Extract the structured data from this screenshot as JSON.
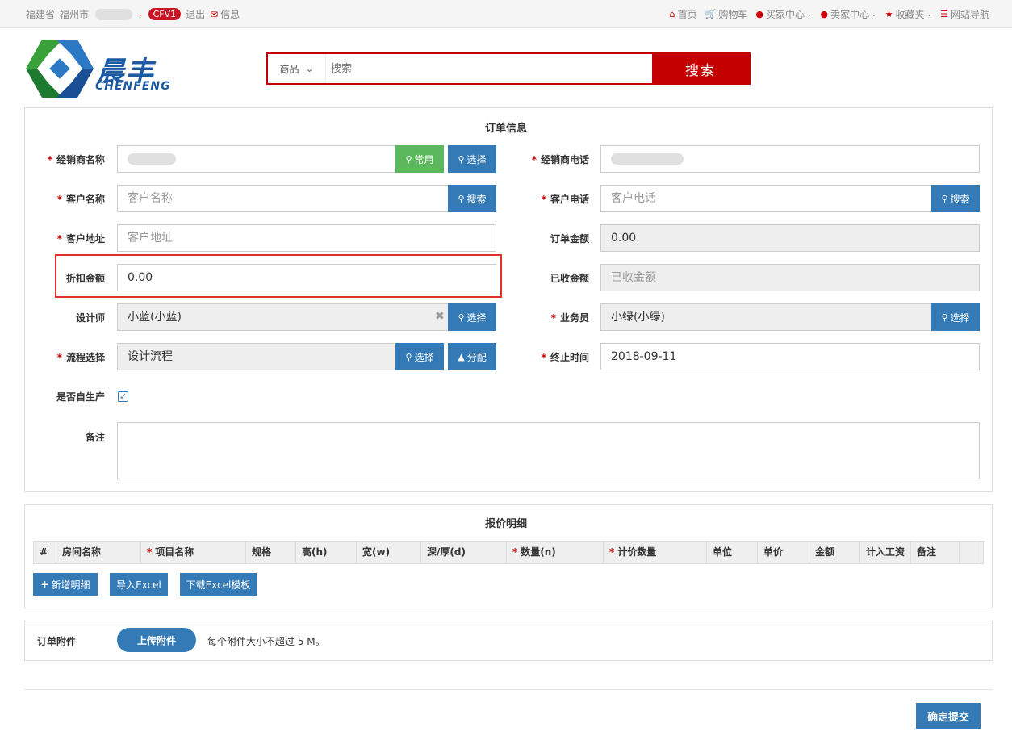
{
  "topbar": {
    "province": "福建省",
    "city": "福州市",
    "badge": "CFV1",
    "logout": "退出",
    "messages": "信息",
    "right_links": [
      {
        "icon": "home-icon",
        "glyph": "⌂",
        "label": "首页"
      },
      {
        "icon": "cart-icon",
        "glyph": "🛒",
        "label": "购物车"
      },
      {
        "icon": "user-icon",
        "glyph": "●",
        "label": "买家中心"
      },
      {
        "icon": "user-icon",
        "glyph": "●",
        "label": "卖家中心"
      },
      {
        "icon": "star-icon",
        "glyph": "★",
        "label": "收藏夹"
      },
      {
        "icon": "list-icon",
        "glyph": "☰",
        "label": "网站导航"
      }
    ]
  },
  "logo": {
    "cn": "晨丰",
    "en": "CHENFENG"
  },
  "search": {
    "category": "商品",
    "placeholder": "搜索",
    "button": "搜索"
  },
  "order": {
    "title": "订单信息",
    "dealer_name_label": "经销商名称",
    "dealer_phone_label": "经销商电话",
    "common_btn": "常用",
    "select_btn": "选择",
    "search_btn": "搜索",
    "distribute_btn": "分配",
    "customer_name_label": "客户名称",
    "customer_name_placeholder": "客户名称",
    "customer_phone_label": "客户电话",
    "customer_phone_placeholder": "客户电话",
    "customer_addr_label": "客户地址",
    "customer_addr_placeholder": "客户地址",
    "order_amount_label": "订单金额",
    "order_amount": "0.00",
    "discount_label": "折扣金额",
    "discount": "0.00",
    "received_label": "已收金额",
    "received_placeholder": "已收金额",
    "designer_label": "设计师",
    "designer": "小蓝(小蓝)",
    "salesman_label": "业务员",
    "salesman": "小绿(小绿)",
    "flow_label": "流程选择",
    "flow": "设计流程",
    "deadline_label": "终止时间",
    "deadline": "2018-09-11",
    "self_produce_label": "是否自生产",
    "self_produce_checked": true,
    "remark_label": "备注"
  },
  "quote": {
    "title": "报价明细",
    "columns": [
      {
        "label": "#",
        "req": false
      },
      {
        "label": "房间名称",
        "req": false
      },
      {
        "label": "项目名称",
        "req": true
      },
      {
        "label": "规格",
        "req": false
      },
      {
        "label": "高(h)",
        "req": false
      },
      {
        "label": "宽(w)",
        "req": false
      },
      {
        "label": "深/厚(d)",
        "req": false
      },
      {
        "label": "数量(n)",
        "req": true
      },
      {
        "label": "计价数量",
        "req": true
      },
      {
        "label": "单位",
        "req": false
      },
      {
        "label": "单价",
        "req": false
      },
      {
        "label": "金额",
        "req": false
      },
      {
        "label": "计入工资",
        "req": false
      },
      {
        "label": "备注",
        "req": false
      },
      {
        "label": "",
        "req": false
      }
    ],
    "add_btn": "新增明细",
    "import_btn": "导入Excel",
    "download_btn": "下载Excel模板"
  },
  "attach": {
    "label": "订单附件",
    "upload_btn": "上传附件",
    "hint": "每个附件大小不超过 5 M。"
  },
  "submit": "确定提交",
  "colors": {
    "brand_red": "#c40000",
    "primary": "#337ab7",
    "success": "#5cb85c"
  }
}
